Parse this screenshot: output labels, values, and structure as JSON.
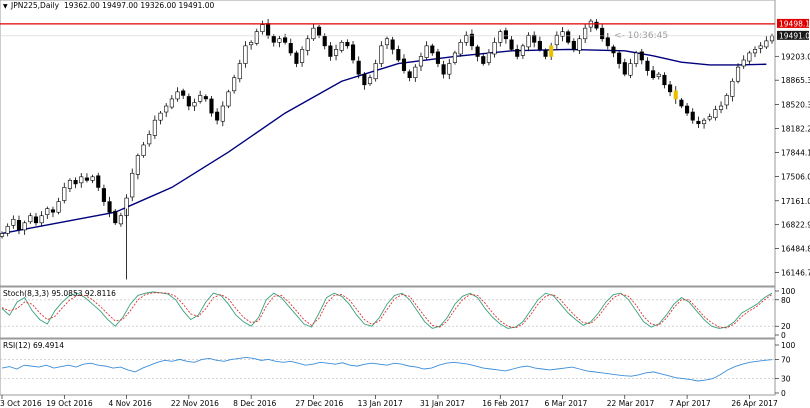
{
  "header": {
    "marker": "▼",
    "symbol_label": "JPN225,Daily",
    "ohlc": "19362.00 19497.00 19326.00 19491.00"
  },
  "timer": "<- 10:36:45",
  "stoch_label": "Stoch(8,3,3) 95.0853 92.8116",
  "rsi_label": "RSI(12) 69.4914",
  "colors": {
    "background": "#ffffff",
    "candle_line": "#000000",
    "moving_average": "#00007f",
    "stoch_main": "#3aa17e",
    "stoch_signal": "#e03030",
    "rsi_line": "#3b8ed8",
    "highlight_line": "#e00000",
    "highlight_candle": "#e8c000"
  },
  "chart_data": [
    {
      "type": "candlestick",
      "ylim": [
        16000,
        19800
      ],
      "yticks": [
        "19203.00",
        "18865.30",
        "18520.30",
        "18182.20",
        "17844.10",
        "17506.00",
        "17161.00",
        "16822.90",
        "16484.80",
        "16146.70"
      ],
      "ytick_values": [
        19203,
        18865.3,
        18520.3,
        18182.2,
        17844.1,
        17506,
        17161,
        16822.9,
        16484.8,
        16146.7
      ],
      "price_labels": [
        {
          "text": "19498.19",
          "value": 19498.19,
          "style": "red"
        },
        {
          "text": "19491.00",
          "value": 19491,
          "style": "dark"
        }
      ],
      "x_labels": [
        "3 Oct 2016",
        "19 Oct 2016",
        "4 Nov 2016",
        "22 Nov 2016",
        "8 Dec 2016",
        "27 Dec 2016",
        "13 Jan 2017",
        "31 Jan 2017",
        "16 Feb 2017",
        "6 Mar 2017",
        "22 Mar 2017",
        "7 Apr 2017",
        "26 Apr 2017"
      ],
      "x_label_index": [
        0,
        11,
        22,
        33,
        44,
        55,
        66,
        77,
        88,
        99,
        110,
        121,
        132
      ],
      "highlight_line_value": 19660,
      "moving_average": {
        "index": [
          0,
          10,
          20,
          30,
          40,
          50,
          60,
          70,
          80,
          90,
          100,
          110,
          115,
          120,
          125,
          130,
          135
        ],
        "values": [
          16700,
          16850,
          17000,
          17350,
          17850,
          18400,
          18850,
          19100,
          19200,
          19280,
          19300,
          19280,
          19210,
          19120,
          19080,
          19080,
          19090
        ]
      },
      "closes": [
        16700,
        16800,
        16900,
        16750,
        16850,
        16950,
        16850,
        16950,
        17050,
        17000,
        17150,
        17350,
        17450,
        17400,
        17500,
        17450,
        17500,
        17350,
        17150,
        17000,
        16850,
        16950,
        17200,
        17550,
        17800,
        17950,
        18100,
        18300,
        18400,
        18500,
        18600,
        18700,
        18650,
        18500,
        18550,
        18650,
        18600,
        18400,
        18300,
        18500,
        18700,
        18900,
        19100,
        19350,
        19400,
        19550,
        19650,
        19500,
        19400,
        19450,
        19400,
        19250,
        19100,
        19300,
        19450,
        19600,
        19500,
        19350,
        19200,
        19300,
        19400,
        19350,
        19150,
        18950,
        18800,
        18900,
        19100,
        19350,
        19450,
        19300,
        19150,
        19000,
        18900,
        19050,
        19200,
        19350,
        19250,
        19100,
        18950,
        19100,
        19250,
        19400,
        19500,
        19350,
        19200,
        19100,
        19250,
        19400,
        19550,
        19450,
        19300,
        19200,
        19350,
        19500,
        19400,
        19300,
        19200,
        19350,
        19500,
        19550,
        19400,
        19300,
        19450,
        19600,
        19700,
        19600,
        19450,
        19350,
        19250,
        19100,
        18950,
        19100,
        19250,
        19150,
        19000,
        18900,
        18950,
        18800,
        18700,
        18600,
        18500,
        18400,
        18300,
        18250,
        18300,
        18350,
        18450,
        18500,
        18650,
        18850,
        19050,
        19150,
        19250,
        19300,
        19350,
        19420,
        19491
      ]
    },
    {
      "type": "line",
      "title": "Stoch(8,3,3) 95.0853 92.8116",
      "ylim": [
        0,
        100
      ],
      "yticks": [
        100,
        80,
        20,
        0
      ],
      "series": [
        {
          "name": "main",
          "values": [
            60,
            45,
            75,
            85,
            55,
            35,
            25,
            55,
            75,
            90,
            95,
            85,
            70,
            55,
            35,
            20,
            40,
            70,
            90,
            95,
            98,
            96,
            93,
            80,
            55,
            35,
            45,
            75,
            95,
            90,
            70,
            45,
            30,
            20,
            40,
            80,
            95,
            85,
            65,
            45,
            25,
            18,
            50,
            85,
            95,
            88,
            70,
            45,
            25,
            20,
            40,
            70,
            90,
            95,
            80,
            55,
            30,
            15,
            20,
            40,
            70,
            88,
            95,
            85,
            60,
            40,
            25,
            15,
            18,
            30,
            55,
            80,
            95,
            90,
            70,
            50,
            35,
            22,
            30,
            50,
            75,
            92,
            95,
            80,
            55,
            30,
            18,
            25,
            45,
            70,
            85,
            75,
            55,
            35,
            20,
            15,
            18,
            30,
            50,
            60,
            70,
            85,
            95
          ]
        },
        {
          "name": "signal",
          "values": [
            62,
            55,
            60,
            75,
            70,
            50,
            35,
            42,
            62,
            80,
            90,
            90,
            80,
            65,
            48,
            32,
            35,
            55,
            80,
            92,
            96,
            96,
            95,
            88,
            70,
            48,
            42,
            60,
            85,
            92,
            82,
            60,
            40,
            28,
            32,
            65,
            88,
            90,
            75,
            55,
            35,
            22,
            38,
            72,
            90,
            92,
            80,
            58,
            35,
            24,
            32,
            58,
            82,
            92,
            88,
            65,
            42,
            22,
            18,
            32,
            58,
            80,
            92,
            90,
            72,
            50,
            32,
            20,
            16,
            25,
            45,
            70,
            88,
            92,
            80,
            60,
            42,
            28,
            26,
            42,
            65,
            85,
            93,
            88,
            68,
            42,
            25,
            22,
            38,
            62,
            80,
            80,
            62,
            42,
            28,
            18,
            16,
            25,
            42,
            55,
            65,
            80,
            92
          ]
        }
      ]
    },
    {
      "type": "line",
      "title": "RSI(12) 69.4914",
      "ylim": [
        0,
        100
      ],
      "yticks": [
        100,
        70,
        30,
        0
      ],
      "series": [
        {
          "name": "RSI",
          "values": [
            52,
            55,
            50,
            58,
            56,
            54,
            58,
            52,
            55,
            58,
            54,
            60,
            62,
            58,
            56,
            52,
            54,
            48,
            44,
            52,
            58,
            64,
            68,
            66,
            70,
            66,
            64,
            70,
            72,
            68,
            66,
            70,
            72,
            74,
            72,
            68,
            70,
            66,
            64,
            66,
            62,
            58,
            60,
            64,
            62,
            60,
            63,
            58,
            56,
            60,
            62,
            60,
            58,
            62,
            60,
            56,
            54,
            50,
            52,
            58,
            62,
            64,
            62,
            60,
            56,
            52,
            50,
            48,
            46,
            50,
            54,
            56,
            52,
            50,
            48,
            50,
            52,
            54,
            50,
            46,
            44,
            42,
            40,
            38,
            36,
            35,
            38,
            42,
            44,
            40,
            36,
            32,
            30,
            28,
            25,
            27,
            30,
            38,
            48,
            55,
            60,
            64,
            66,
            68,
            69.4914
          ]
        }
      ]
    }
  ]
}
